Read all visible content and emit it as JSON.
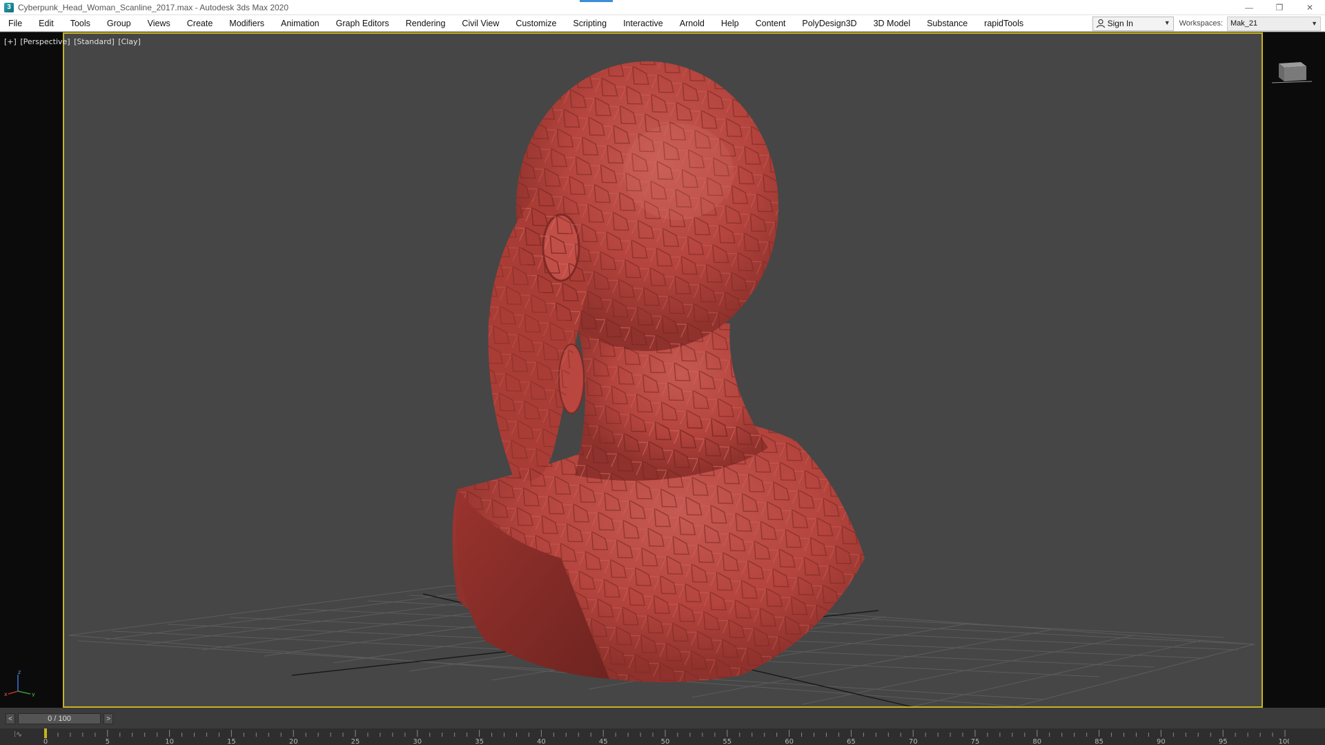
{
  "window": {
    "title": "Cyberpunk_Head_Woman_Scanline_2017.max - Autodesk 3ds Max 2020",
    "controls": {
      "minimize": "—",
      "restore": "❐",
      "close": "✕"
    }
  },
  "menu": {
    "items": [
      "File",
      "Edit",
      "Tools",
      "Group",
      "Views",
      "Create",
      "Modifiers",
      "Animation",
      "Graph Editors",
      "Rendering",
      "Civil View",
      "Customize",
      "Scripting",
      "Interactive",
      "Arnold",
      "Help",
      "Content",
      "PolyDesign3D",
      "3D Model",
      "Substance",
      "rapidTools"
    ],
    "sign_in": "Sign In",
    "workspaces_label": "Workspaces:",
    "workspace_value": "Mak_21"
  },
  "viewport": {
    "labels": [
      "[+]",
      "[Perspective]",
      "[Standard]",
      "[Clay]"
    ],
    "axis": {
      "x": "x",
      "y": "y",
      "z": "z"
    },
    "model_color": "#b4443d",
    "border_color": "#c8b41e"
  },
  "timeline": {
    "frame_display": "0 / 100",
    "prev": "<",
    "next": ">",
    "ticks": [
      0,
      5,
      10,
      15,
      20,
      25,
      30,
      35,
      40,
      45,
      50,
      55,
      60,
      65,
      70,
      75,
      80,
      85,
      90,
      95,
      100
    ]
  },
  "icons": {
    "app": "3ds-max-icon",
    "user": "user-icon",
    "viewcube": "viewcube-icon",
    "key": "key-mode-icon"
  }
}
